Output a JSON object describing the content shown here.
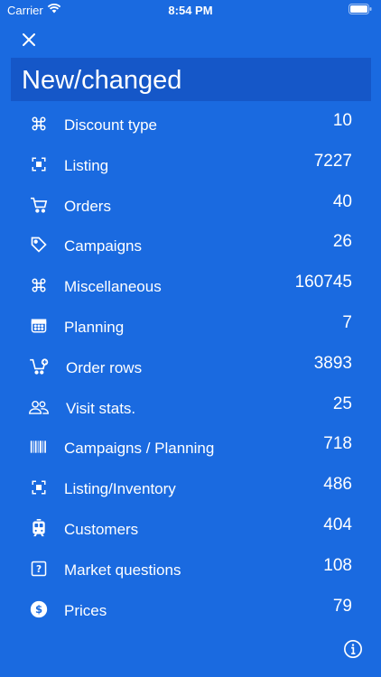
{
  "status": {
    "carrier": "Carrier",
    "time": "8:54 PM"
  },
  "header": {
    "title": "New/changed"
  },
  "rows": [
    {
      "label": "Discount type",
      "value": "10",
      "icon": "command-icon"
    },
    {
      "label": "Listing",
      "value": "7227",
      "icon": "scan-icon"
    },
    {
      "label": "Orders",
      "value": "40",
      "icon": "cart-icon"
    },
    {
      "label": "Campaigns",
      "value": "26",
      "icon": "tag-icon"
    },
    {
      "label": "Miscellaneous",
      "value": "160745",
      "icon": "command-icon"
    },
    {
      "label": "Planning",
      "value": "7",
      "icon": "calendar-icon"
    },
    {
      "label": "Order rows",
      "value": "3893",
      "icon": "cart-add-icon"
    },
    {
      "label": "Visit stats.",
      "value": "25",
      "icon": "people-icon"
    },
    {
      "label": "Campaigns / Planning",
      "value": "718",
      "icon": "barcode-icon"
    },
    {
      "label": "Listing/Inventory",
      "value": "486",
      "icon": "scan-icon"
    },
    {
      "label": "Customers",
      "value": "404",
      "icon": "tram-icon"
    },
    {
      "label": "Market questions",
      "value": "108",
      "icon": "question-box-icon"
    },
    {
      "label": "Prices",
      "value": "79",
      "icon": "dollar-circle-icon"
    }
  ]
}
